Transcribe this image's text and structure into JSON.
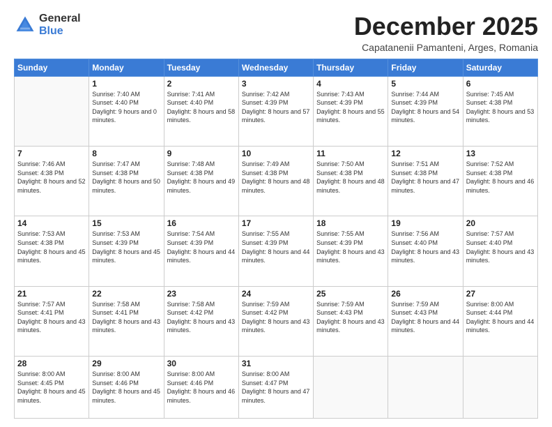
{
  "logo": {
    "general": "General",
    "blue": "Blue"
  },
  "title": "December 2025",
  "subtitle": "Capatanenii Pamanteni, Arges, Romania",
  "days_header": [
    "Sunday",
    "Monday",
    "Tuesday",
    "Wednesday",
    "Thursday",
    "Friday",
    "Saturday"
  ],
  "weeks": [
    [
      {
        "day": "",
        "sunrise": "",
        "sunset": "",
        "daylight": ""
      },
      {
        "day": "1",
        "sunrise": "Sunrise: 7:40 AM",
        "sunset": "Sunset: 4:40 PM",
        "daylight": "Daylight: 9 hours and 0 minutes."
      },
      {
        "day": "2",
        "sunrise": "Sunrise: 7:41 AM",
        "sunset": "Sunset: 4:40 PM",
        "daylight": "Daylight: 8 hours and 58 minutes."
      },
      {
        "day": "3",
        "sunrise": "Sunrise: 7:42 AM",
        "sunset": "Sunset: 4:39 PM",
        "daylight": "Daylight: 8 hours and 57 minutes."
      },
      {
        "day": "4",
        "sunrise": "Sunrise: 7:43 AM",
        "sunset": "Sunset: 4:39 PM",
        "daylight": "Daylight: 8 hours and 55 minutes."
      },
      {
        "day": "5",
        "sunrise": "Sunrise: 7:44 AM",
        "sunset": "Sunset: 4:39 PM",
        "daylight": "Daylight: 8 hours and 54 minutes."
      },
      {
        "day": "6",
        "sunrise": "Sunrise: 7:45 AM",
        "sunset": "Sunset: 4:38 PM",
        "daylight": "Daylight: 8 hours and 53 minutes."
      }
    ],
    [
      {
        "day": "7",
        "sunrise": "Sunrise: 7:46 AM",
        "sunset": "Sunset: 4:38 PM",
        "daylight": "Daylight: 8 hours and 52 minutes."
      },
      {
        "day": "8",
        "sunrise": "Sunrise: 7:47 AM",
        "sunset": "Sunset: 4:38 PM",
        "daylight": "Daylight: 8 hours and 50 minutes."
      },
      {
        "day": "9",
        "sunrise": "Sunrise: 7:48 AM",
        "sunset": "Sunset: 4:38 PM",
        "daylight": "Daylight: 8 hours and 49 minutes."
      },
      {
        "day": "10",
        "sunrise": "Sunrise: 7:49 AM",
        "sunset": "Sunset: 4:38 PM",
        "daylight": "Daylight: 8 hours and 48 minutes."
      },
      {
        "day": "11",
        "sunrise": "Sunrise: 7:50 AM",
        "sunset": "Sunset: 4:38 PM",
        "daylight": "Daylight: 8 hours and 48 minutes."
      },
      {
        "day": "12",
        "sunrise": "Sunrise: 7:51 AM",
        "sunset": "Sunset: 4:38 PM",
        "daylight": "Daylight: 8 hours and 47 minutes."
      },
      {
        "day": "13",
        "sunrise": "Sunrise: 7:52 AM",
        "sunset": "Sunset: 4:38 PM",
        "daylight": "Daylight: 8 hours and 46 minutes."
      }
    ],
    [
      {
        "day": "14",
        "sunrise": "Sunrise: 7:53 AM",
        "sunset": "Sunset: 4:38 PM",
        "daylight": "Daylight: 8 hours and 45 minutes."
      },
      {
        "day": "15",
        "sunrise": "Sunrise: 7:53 AM",
        "sunset": "Sunset: 4:39 PM",
        "daylight": "Daylight: 8 hours and 45 minutes."
      },
      {
        "day": "16",
        "sunrise": "Sunrise: 7:54 AM",
        "sunset": "Sunset: 4:39 PM",
        "daylight": "Daylight: 8 hours and 44 minutes."
      },
      {
        "day": "17",
        "sunrise": "Sunrise: 7:55 AM",
        "sunset": "Sunset: 4:39 PM",
        "daylight": "Daylight: 8 hours and 44 minutes."
      },
      {
        "day": "18",
        "sunrise": "Sunrise: 7:55 AM",
        "sunset": "Sunset: 4:39 PM",
        "daylight": "Daylight: 8 hours and 43 minutes."
      },
      {
        "day": "19",
        "sunrise": "Sunrise: 7:56 AM",
        "sunset": "Sunset: 4:40 PM",
        "daylight": "Daylight: 8 hours and 43 minutes."
      },
      {
        "day": "20",
        "sunrise": "Sunrise: 7:57 AM",
        "sunset": "Sunset: 4:40 PM",
        "daylight": "Daylight: 8 hours and 43 minutes."
      }
    ],
    [
      {
        "day": "21",
        "sunrise": "Sunrise: 7:57 AM",
        "sunset": "Sunset: 4:41 PM",
        "daylight": "Daylight: 8 hours and 43 minutes."
      },
      {
        "day": "22",
        "sunrise": "Sunrise: 7:58 AM",
        "sunset": "Sunset: 4:41 PM",
        "daylight": "Daylight: 8 hours and 43 minutes."
      },
      {
        "day": "23",
        "sunrise": "Sunrise: 7:58 AM",
        "sunset": "Sunset: 4:42 PM",
        "daylight": "Daylight: 8 hours and 43 minutes."
      },
      {
        "day": "24",
        "sunrise": "Sunrise: 7:59 AM",
        "sunset": "Sunset: 4:42 PM",
        "daylight": "Daylight: 8 hours and 43 minutes."
      },
      {
        "day": "25",
        "sunrise": "Sunrise: 7:59 AM",
        "sunset": "Sunset: 4:43 PM",
        "daylight": "Daylight: 8 hours and 43 minutes."
      },
      {
        "day": "26",
        "sunrise": "Sunrise: 7:59 AM",
        "sunset": "Sunset: 4:43 PM",
        "daylight": "Daylight: 8 hours and 44 minutes."
      },
      {
        "day": "27",
        "sunrise": "Sunrise: 8:00 AM",
        "sunset": "Sunset: 4:44 PM",
        "daylight": "Daylight: 8 hours and 44 minutes."
      }
    ],
    [
      {
        "day": "28",
        "sunrise": "Sunrise: 8:00 AM",
        "sunset": "Sunset: 4:45 PM",
        "daylight": "Daylight: 8 hours and 45 minutes."
      },
      {
        "day": "29",
        "sunrise": "Sunrise: 8:00 AM",
        "sunset": "Sunset: 4:46 PM",
        "daylight": "Daylight: 8 hours and 45 minutes."
      },
      {
        "day": "30",
        "sunrise": "Sunrise: 8:00 AM",
        "sunset": "Sunset: 4:46 PM",
        "daylight": "Daylight: 8 hours and 46 minutes."
      },
      {
        "day": "31",
        "sunrise": "Sunrise: 8:00 AM",
        "sunset": "Sunset: 4:47 PM",
        "daylight": "Daylight: 8 hours and 47 minutes."
      },
      {
        "day": "",
        "sunrise": "",
        "sunset": "",
        "daylight": ""
      },
      {
        "day": "",
        "sunrise": "",
        "sunset": "",
        "daylight": ""
      },
      {
        "day": "",
        "sunrise": "",
        "sunset": "",
        "daylight": ""
      }
    ]
  ]
}
